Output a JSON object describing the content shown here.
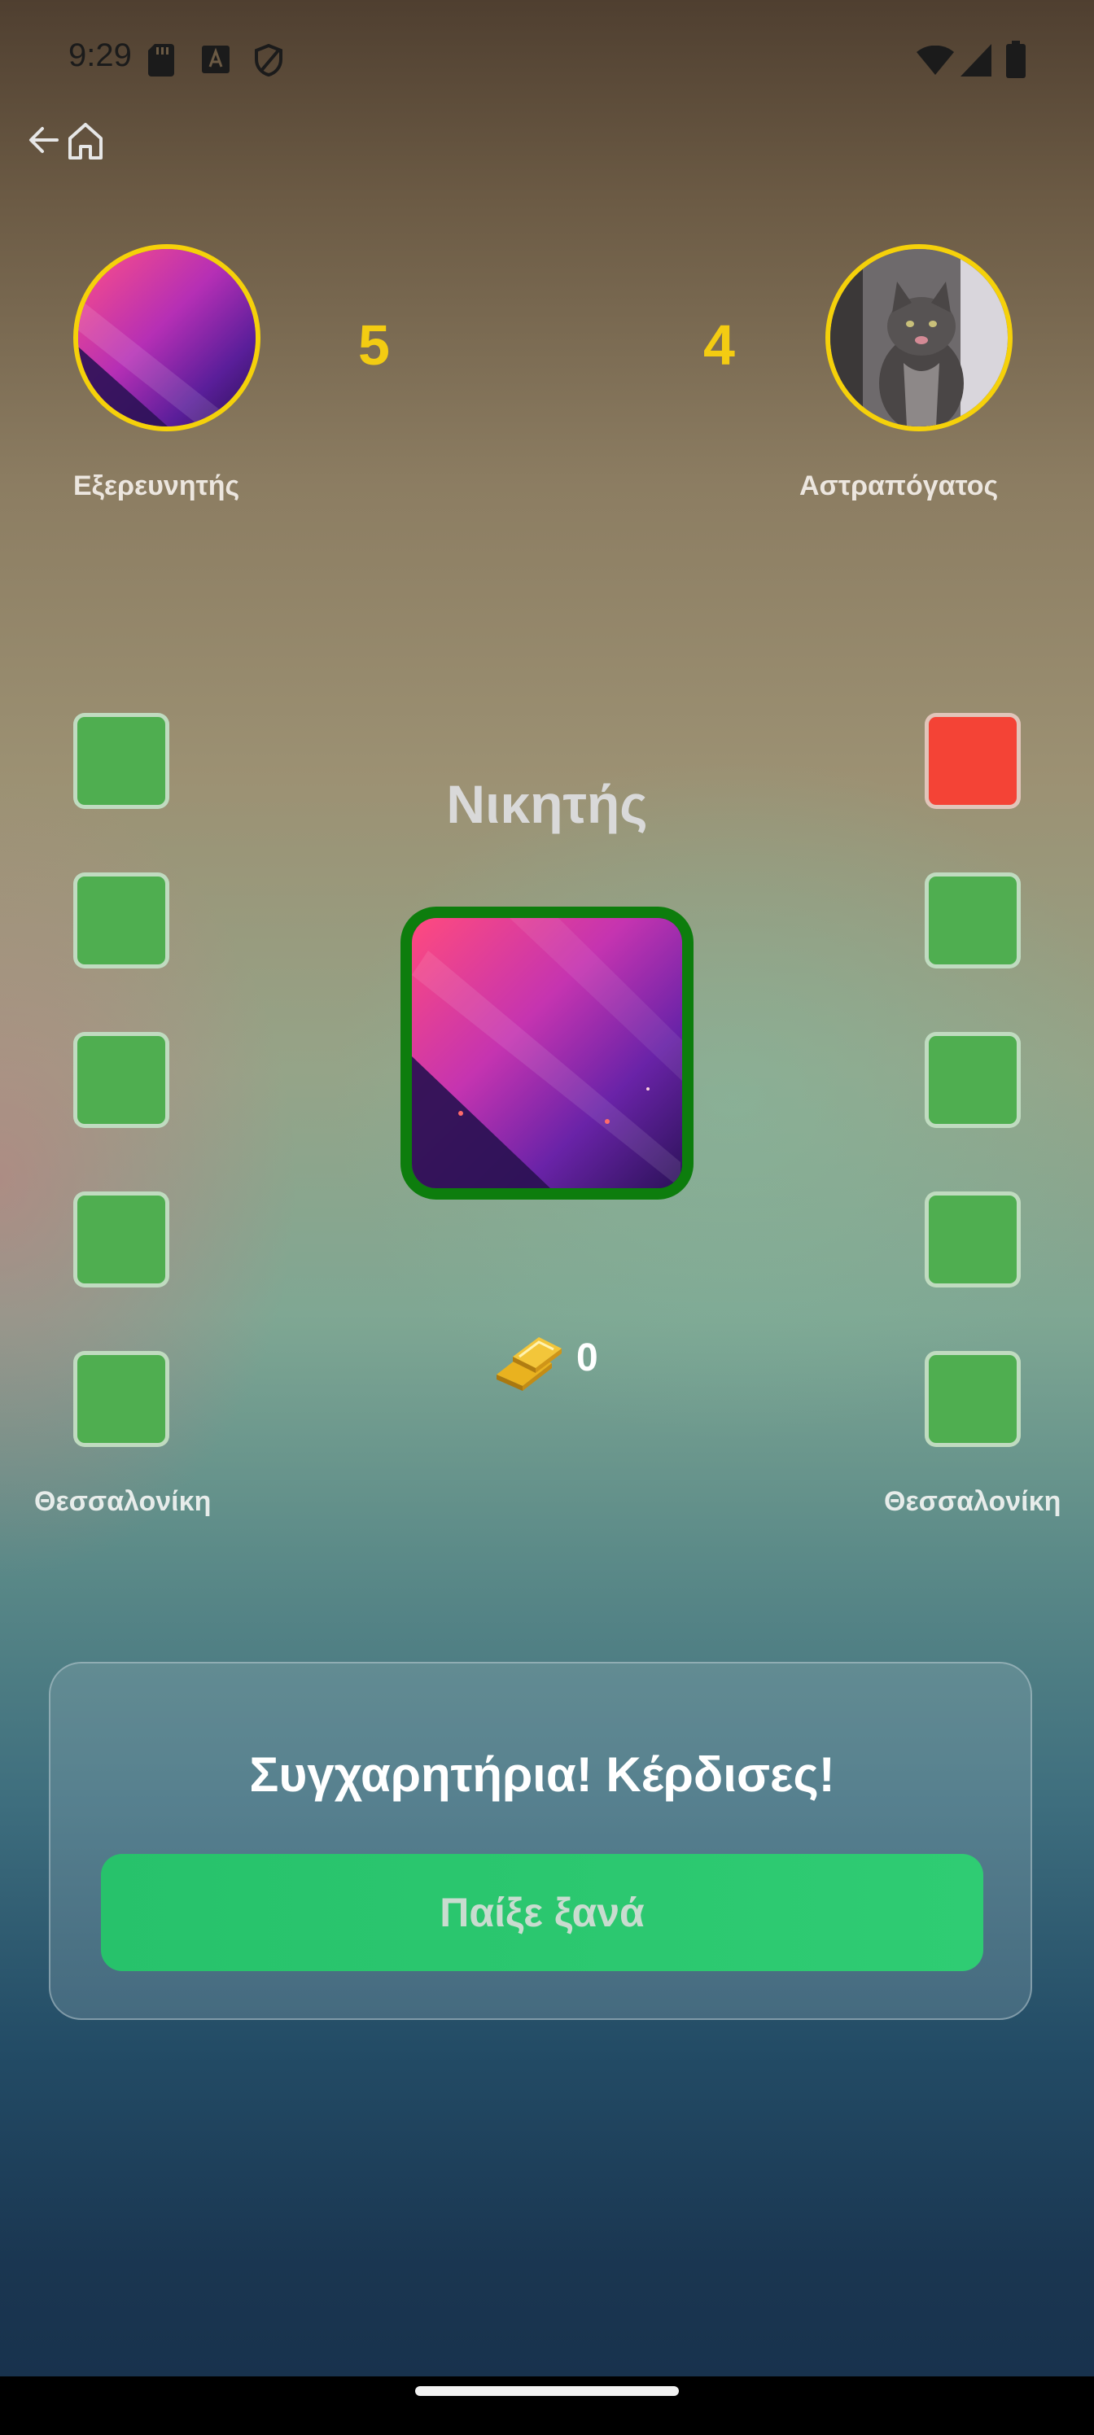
{
  "status_bar": {
    "time": "9:29",
    "icons": [
      "sd-card-icon",
      "a-icon",
      "shield-icon",
      "wifi-icon",
      "signal-icon",
      "battery-icon"
    ]
  },
  "nav": {
    "icons": [
      "back-arrow-icon",
      "home-icon"
    ]
  },
  "players": {
    "left": {
      "name": "Εξερευνητής",
      "score": "5"
    },
    "right": {
      "name": "Αστραπόγατος",
      "score": "4"
    }
  },
  "boards": {
    "left": {
      "results": [
        "correct",
        "correct",
        "correct",
        "correct",
        "correct"
      ],
      "city": "Θεσσαλονίκη"
    },
    "right": {
      "results": [
        "wrong",
        "correct",
        "correct",
        "correct",
        "correct"
      ],
      "city": "Θεσσαλονίκη"
    }
  },
  "winner": {
    "title": "Νικητής"
  },
  "reward": {
    "icon": "gold-bars-icon",
    "gold": "0"
  },
  "result_card": {
    "message": "Συγχαρητήρια! Κέρδισες!",
    "play_again_label": "Παίξε ξανά"
  },
  "colors": {
    "accent_yellow": "#f3cc12",
    "correct_green": "#4fae50",
    "wrong_red": "#f44336",
    "button_green": "#2fcc73",
    "winner_border": "#0d7d0d"
  }
}
